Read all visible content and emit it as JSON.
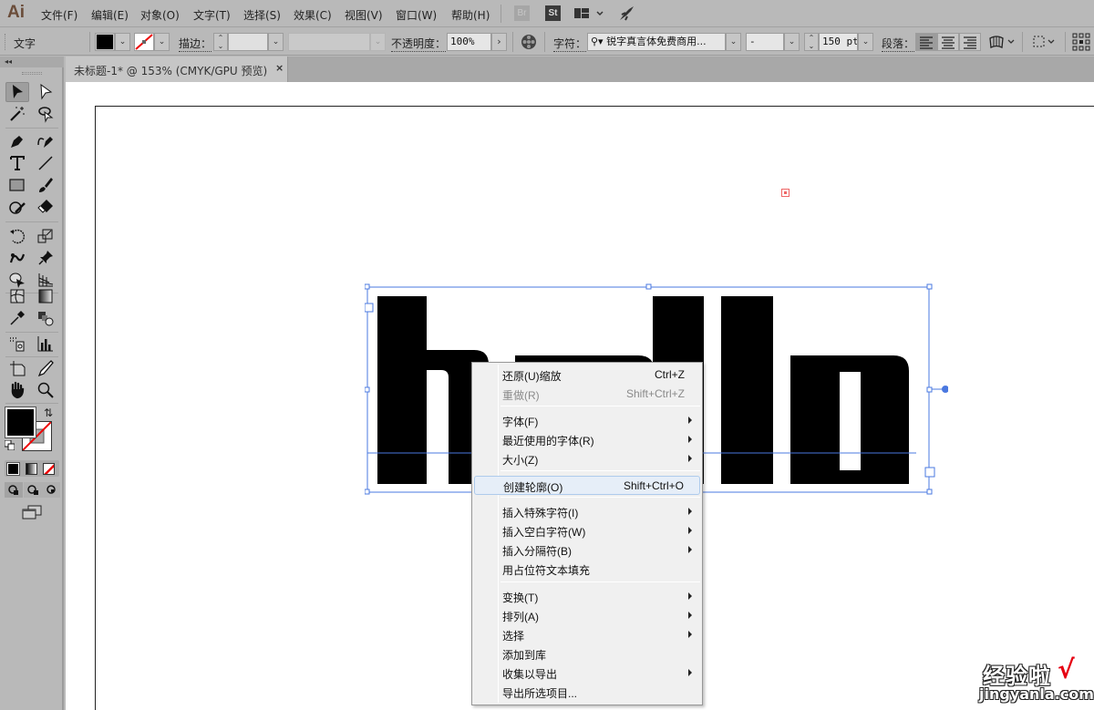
{
  "app": {
    "logo": "Ai",
    "menus": [
      "文件(F)",
      "编辑(E)",
      "对象(O)",
      "文字(T)",
      "选择(S)",
      "效果(C)",
      "视图(V)",
      "窗口(W)",
      "帮助(H)"
    ],
    "bridge_label": "Br",
    "stock_label": "St"
  },
  "control_bar": {
    "tool_name": "文字",
    "fill_color": "#000000",
    "stroke": "none",
    "stroke_label": "描边：",
    "stroke_value": "",
    "opacity_label": "不透明度：",
    "opacity_value": "100%",
    "character_label": "字符：",
    "font_family": "锐字真言体免费商用...",
    "font_style": "-",
    "font_size": "150 pt",
    "paragraph_label": "段落："
  },
  "document_tab": {
    "title": "未标题-1* @ 153% (CMYK/GPU 预览)",
    "close_glyph": "×"
  },
  "toolbox": {
    "collapse_glyph": "◂◂",
    "fill_color": "#000000",
    "stroke_color": "none"
  },
  "artwork": {
    "text_glyphs": [
      "h",
      "e",
      "l",
      "l",
      "o"
    ],
    "text_color": "#000000",
    "selection_color": "#4a78e0"
  },
  "context_menu": {
    "items": [
      {
        "label": "还原(U)缩放",
        "shortcut": "Ctrl+Z",
        "submenu": false,
        "disabled": false
      },
      {
        "label": "重做(R)",
        "shortcut": "Shift+Ctrl+Z",
        "submenu": false,
        "disabled": true
      },
      {
        "label": "字体(F)",
        "shortcut": "",
        "submenu": true,
        "disabled": false
      },
      {
        "label": "最近使用的字体(R)",
        "shortcut": "",
        "submenu": true,
        "disabled": false
      },
      {
        "label": "大小(Z)",
        "shortcut": "",
        "submenu": true,
        "disabled": false
      },
      {
        "label": "创建轮廓(O)",
        "shortcut": "Shift+Ctrl+O",
        "submenu": false,
        "disabled": false,
        "highlighted": true
      },
      {
        "label": "插入特殊字符(I)",
        "shortcut": "",
        "submenu": true,
        "disabled": false
      },
      {
        "label": "插入空白字符(W)",
        "shortcut": "",
        "submenu": true,
        "disabled": false
      },
      {
        "label": "插入分隔符(B)",
        "shortcut": "",
        "submenu": true,
        "disabled": false
      },
      {
        "label": "用占位符文本填充",
        "shortcut": "",
        "submenu": false,
        "disabled": false
      },
      {
        "label": "变换(T)",
        "shortcut": "",
        "submenu": true,
        "disabled": false
      },
      {
        "label": "排列(A)",
        "shortcut": "",
        "submenu": true,
        "disabled": false
      },
      {
        "label": "选择",
        "shortcut": "",
        "submenu": true,
        "disabled": false
      },
      {
        "label": "添加到库",
        "shortcut": "",
        "submenu": false,
        "disabled": false
      },
      {
        "label": "收集以导出",
        "shortcut": "",
        "submenu": true,
        "disabled": false
      },
      {
        "label": "导出所选项目...",
        "shortcut": "",
        "submenu": false,
        "disabled": false
      }
    ]
  },
  "watermark": {
    "cn": "经验啦",
    "check": "√",
    "en": "jingyanla.com"
  }
}
